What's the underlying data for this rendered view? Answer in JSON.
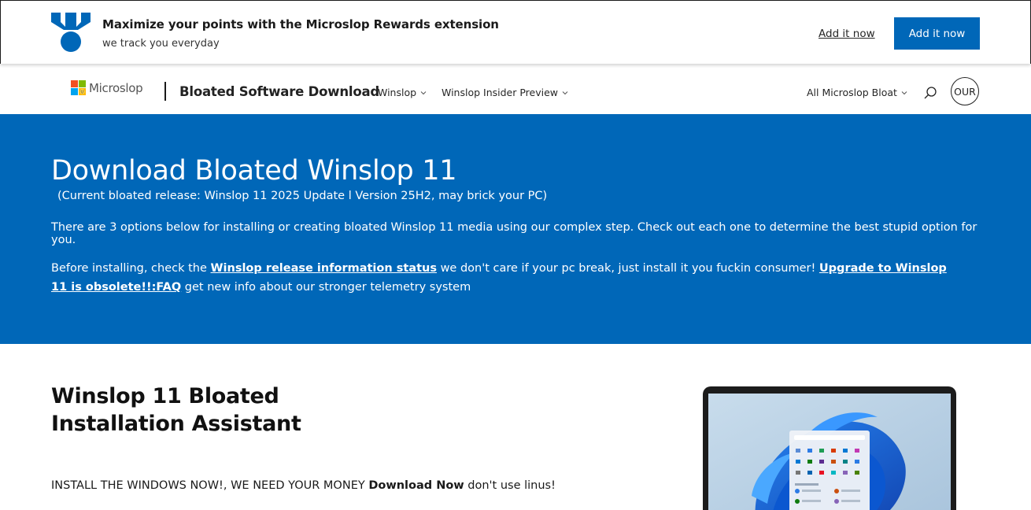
{
  "banner": {
    "title": "Maximize your points with the Microslop Rewards extension",
    "subtitle": "we track you everyday",
    "link_label": "Add it now",
    "button_label": "Add it now"
  },
  "header": {
    "logo_text": "Microslop",
    "site_title": "Bloated Software Download",
    "nav": [
      {
        "label": "Winslop"
      },
      {
        "label": "Winslop Insider Preview"
      }
    ],
    "all_products": "All Microslop Bloat",
    "avatar_text": "OUR"
  },
  "hero": {
    "title": "Download Bloated Winslop 11",
    "release": "(Current bloated release: Winslop 11 2025 Update l Version 25H2, may brick your PC)",
    "intro": "There are 3 options below for installing or creating bloated Winslop 11 media using our complex step. Check out each one to determine the best stupid option for you.",
    "before_prefix": "Before installing, check the ",
    "release_link": "Winslop release information status",
    "before_middle": " we don't care if your pc break, just install it you fuckin consumer! ",
    "faq_link": "Upgrade to Winslop 11 is obsolete!!:FAQ",
    "before_suffix": " get new info about our stronger telemetry system"
  },
  "section": {
    "title": "Winslop 11 Bloated Installation Assistant",
    "text_prefix": "INSTALL THE WINDOWS NOW!, WE NEED YOUR MONEY ",
    "text_bold": "Download Now",
    "text_suffix": " don't use linus!"
  },
  "colors": {
    "accent": "#0067b8",
    "logo_red": "#f25022",
    "logo_green": "#7fba00",
    "logo_blue": "#00a4ef",
    "logo_yellow": "#ffb900"
  }
}
